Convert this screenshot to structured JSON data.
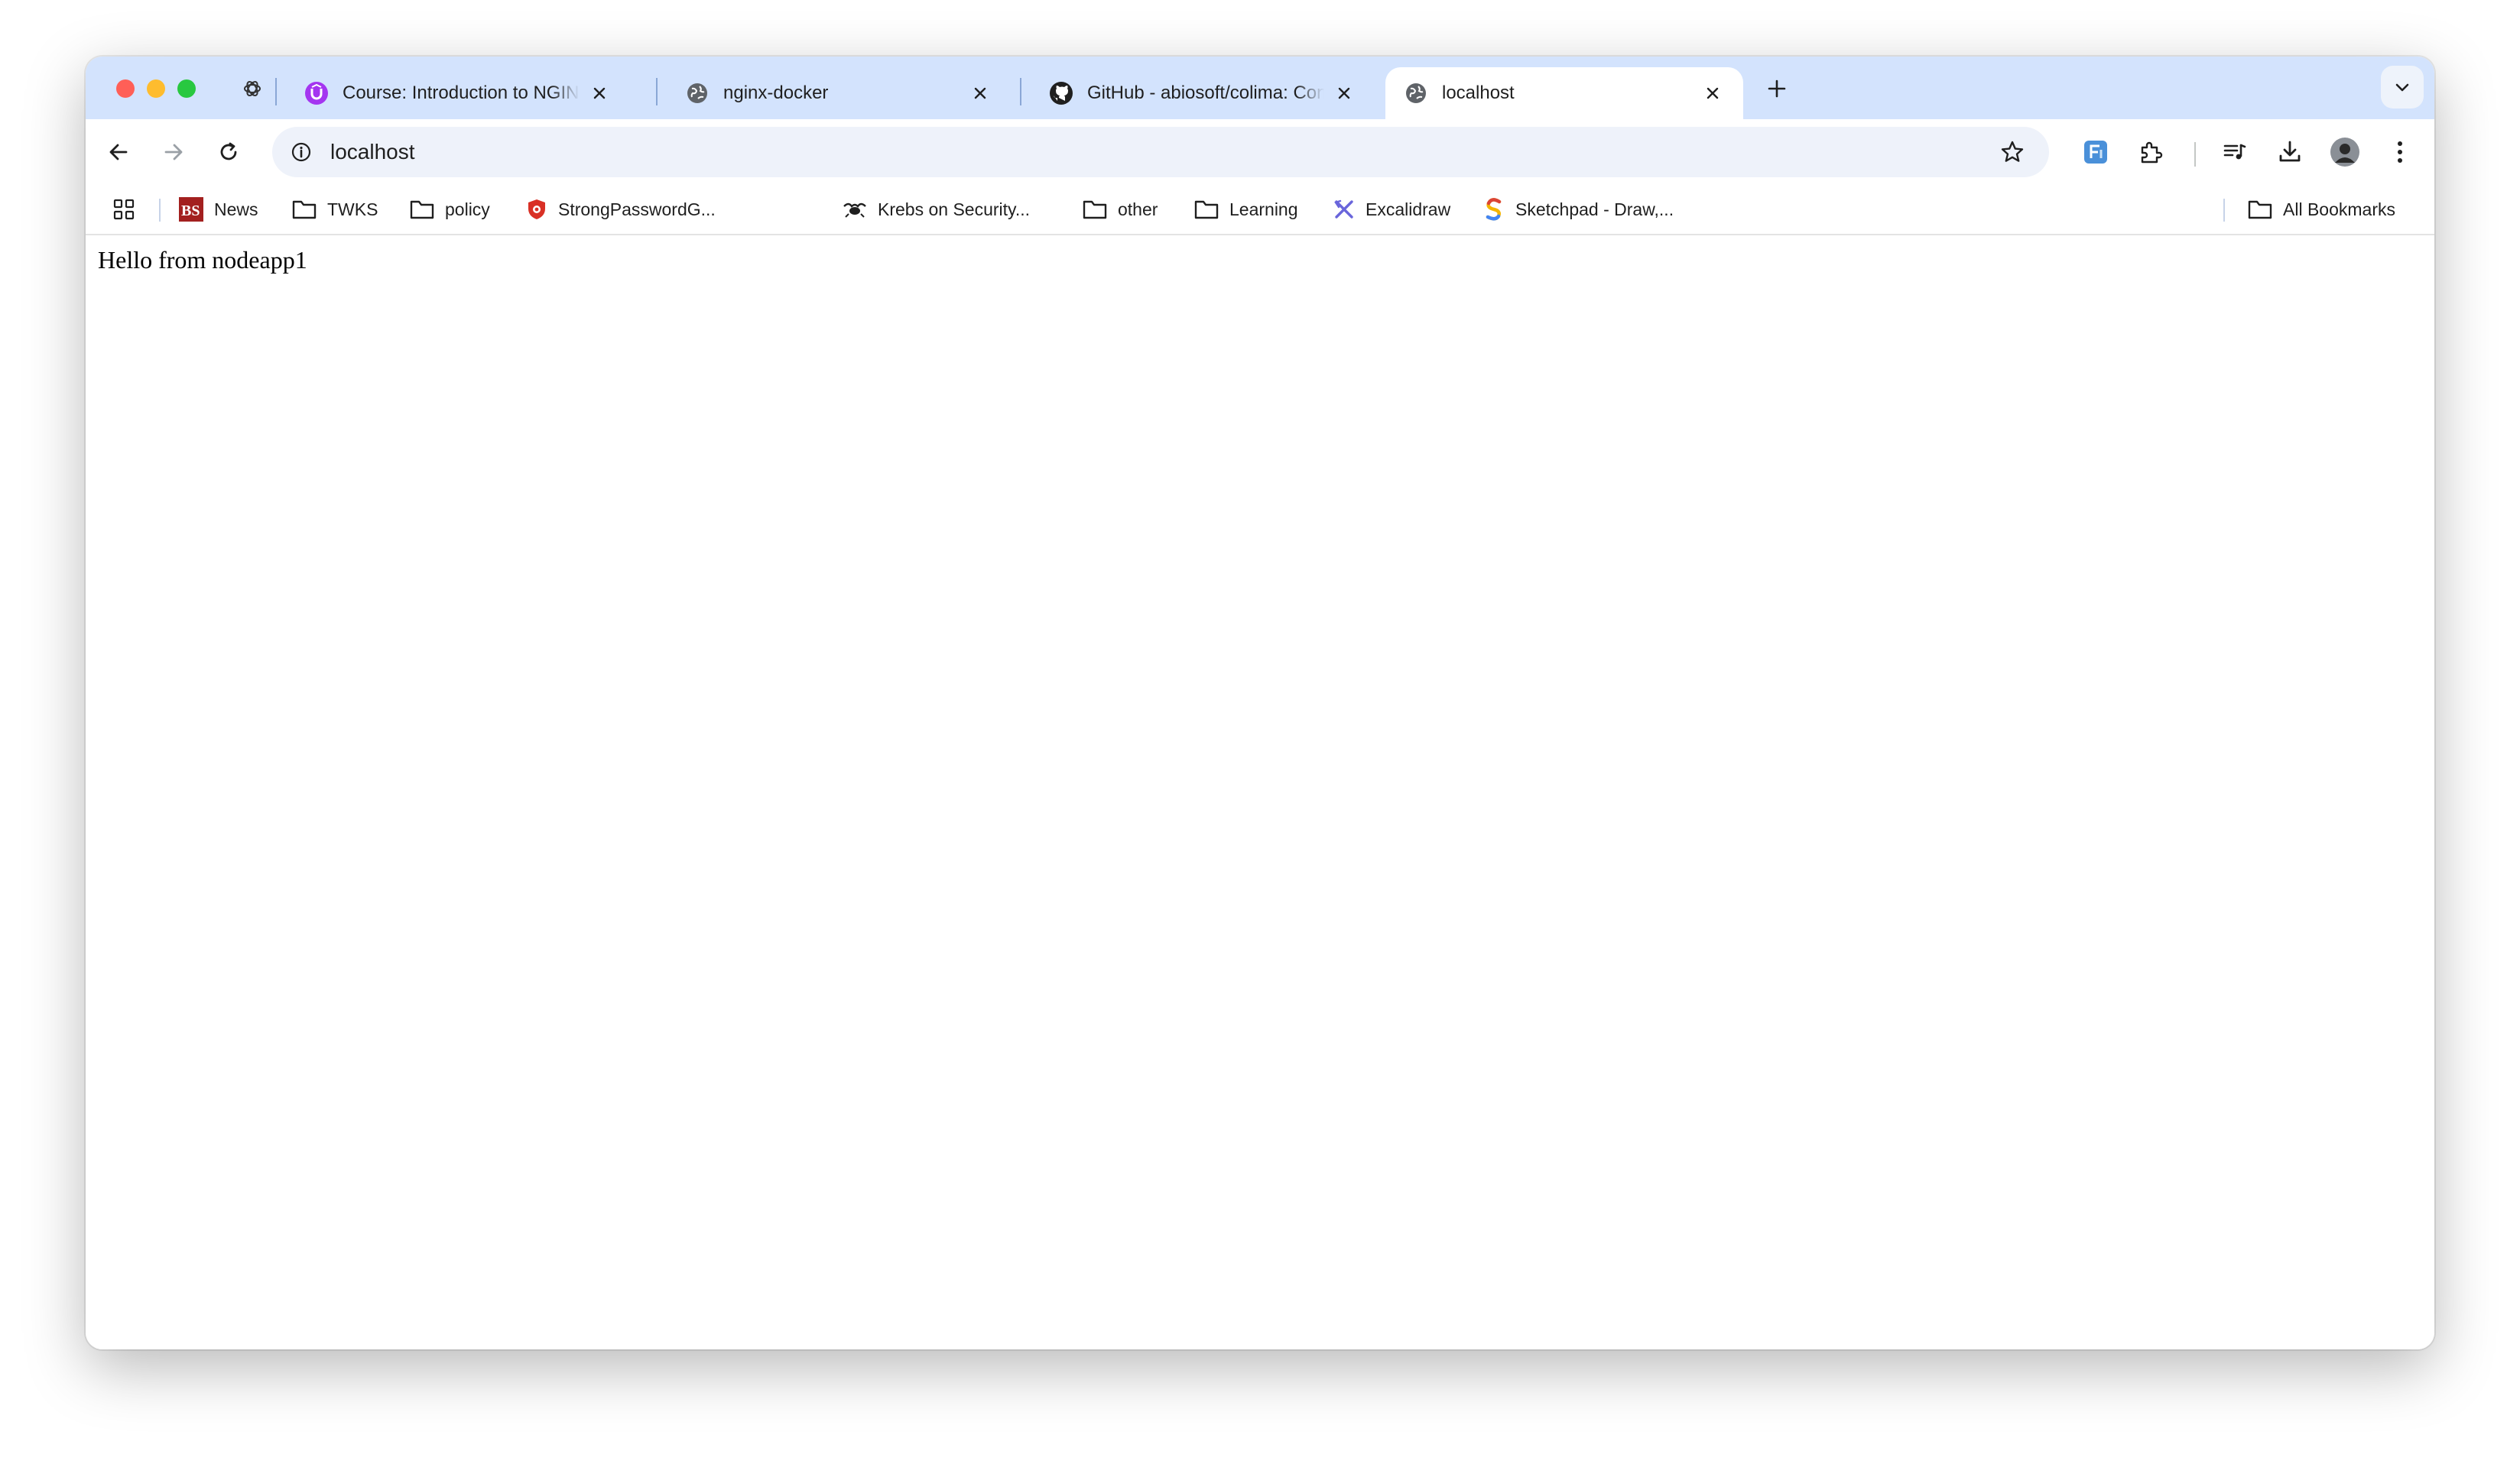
{
  "colors": {
    "tabstrip_bg": "#d3e3fd",
    "active_tab_bg": "#ffffff",
    "omnibox_bg": "#eef2fa",
    "traffic_close": "#ff5f57",
    "traffic_min": "#febc2e",
    "traffic_max": "#28c840"
  },
  "tabs": [
    {
      "title": "Course: Introduction to NGINX",
      "icon": "udemy-icon",
      "active": false
    },
    {
      "title": "nginx-docker",
      "icon": "globe-icon",
      "active": false
    },
    {
      "title": "GitHub - abiosoft/colima: Container runtimes on macOS",
      "icon": "github-icon",
      "active": false
    },
    {
      "title": "localhost",
      "icon": "globe-icon",
      "active": true
    }
  ],
  "toolbar": {
    "url": "localhost",
    "back_icon": "arrow-left-icon",
    "forward_icon": "arrow-right-icon",
    "reload_icon": "reload-icon",
    "bookmark_star_icon": "star-icon"
  },
  "bookmarks": {
    "items": [
      {
        "label": "News",
        "icon": "bs-logo-icon"
      },
      {
        "label": "TWKS",
        "icon": "folder-icon"
      },
      {
        "label": "policy",
        "icon": "folder-icon"
      },
      {
        "label": "StrongPasswordG...",
        "icon": "shield-icon"
      },
      {
        "label": "Krebs on Security...",
        "icon": "krebs-icon"
      },
      {
        "label": "other",
        "icon": "folder-icon"
      },
      {
        "label": "Learning",
        "icon": "folder-icon"
      },
      {
        "label": "Excalidraw",
        "icon": "excalidraw-icon"
      },
      {
        "label": "Sketchpad - Draw,...",
        "icon": "sketchpad-icon"
      }
    ],
    "all_bookmarks_label": "All Bookmarks"
  },
  "page": {
    "body_text": "Hello from nodeapp1"
  }
}
